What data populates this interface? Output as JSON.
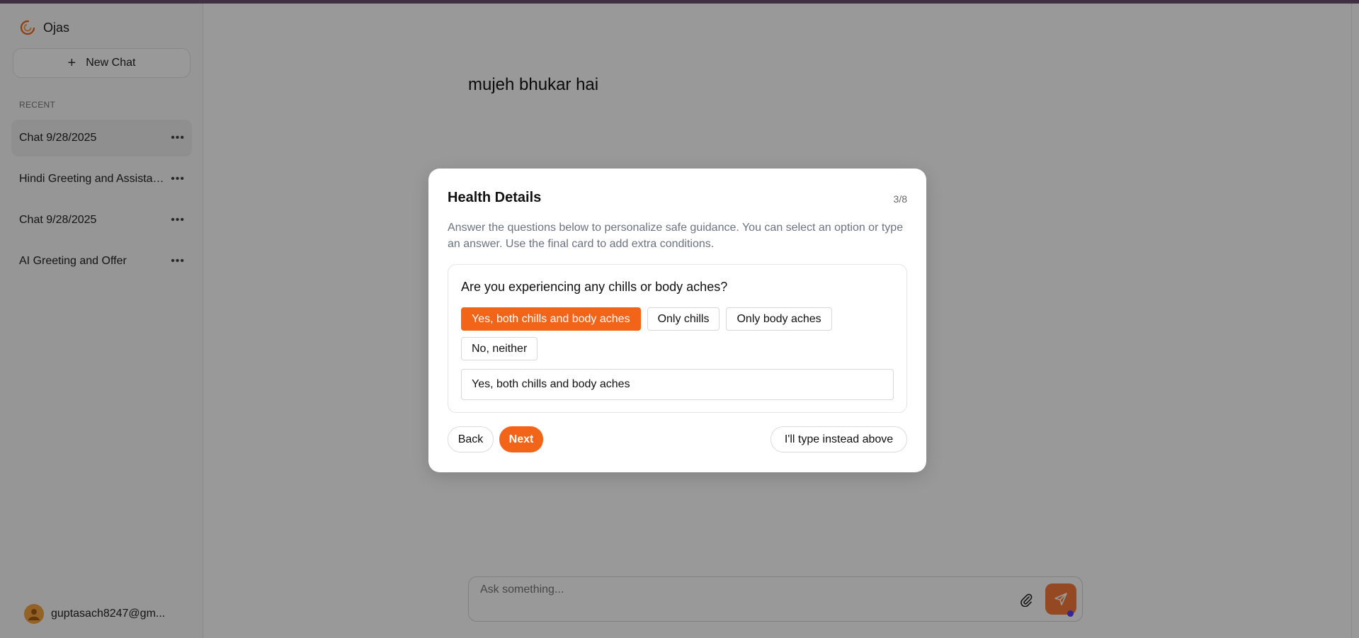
{
  "app": {
    "name": "Ojas"
  },
  "sidebar": {
    "new_chat_label": "New Chat",
    "recent_label": "RECENT",
    "chats": [
      {
        "label": "Chat 9/28/2025",
        "active": true
      },
      {
        "label": "Hindi Greeting and Assistance",
        "active": false
      },
      {
        "label": "Chat 9/28/2025",
        "active": false
      },
      {
        "label": "AI Greeting and Offer",
        "active": false
      }
    ],
    "user_email": "guptasach8247@gm..."
  },
  "main": {
    "user_message": "mujeh bhukar hai",
    "composer_placeholder": "Ask something..."
  },
  "modal": {
    "title": "Health Details",
    "step": "3/8",
    "description": "Answer the questions below to personalize safe guidance. You can select an option or type an answer. Use the final card to add extra conditions.",
    "question": "Are you experiencing any chills or body aches?",
    "options": [
      {
        "label": "Yes, both chills and body aches",
        "selected": true
      },
      {
        "label": "Only chills",
        "selected": false
      },
      {
        "label": "Only body aches",
        "selected": false
      },
      {
        "label": "No, neither",
        "selected": false
      }
    ],
    "answer_value": "Yes, both chills and body aches",
    "back_label": "Back",
    "next_label": "Next",
    "type_instead_label": "I'll type instead above"
  },
  "colors": {
    "accent": "#f26418",
    "topbar": "#6b4e71",
    "send_button": "#f77b3b"
  }
}
